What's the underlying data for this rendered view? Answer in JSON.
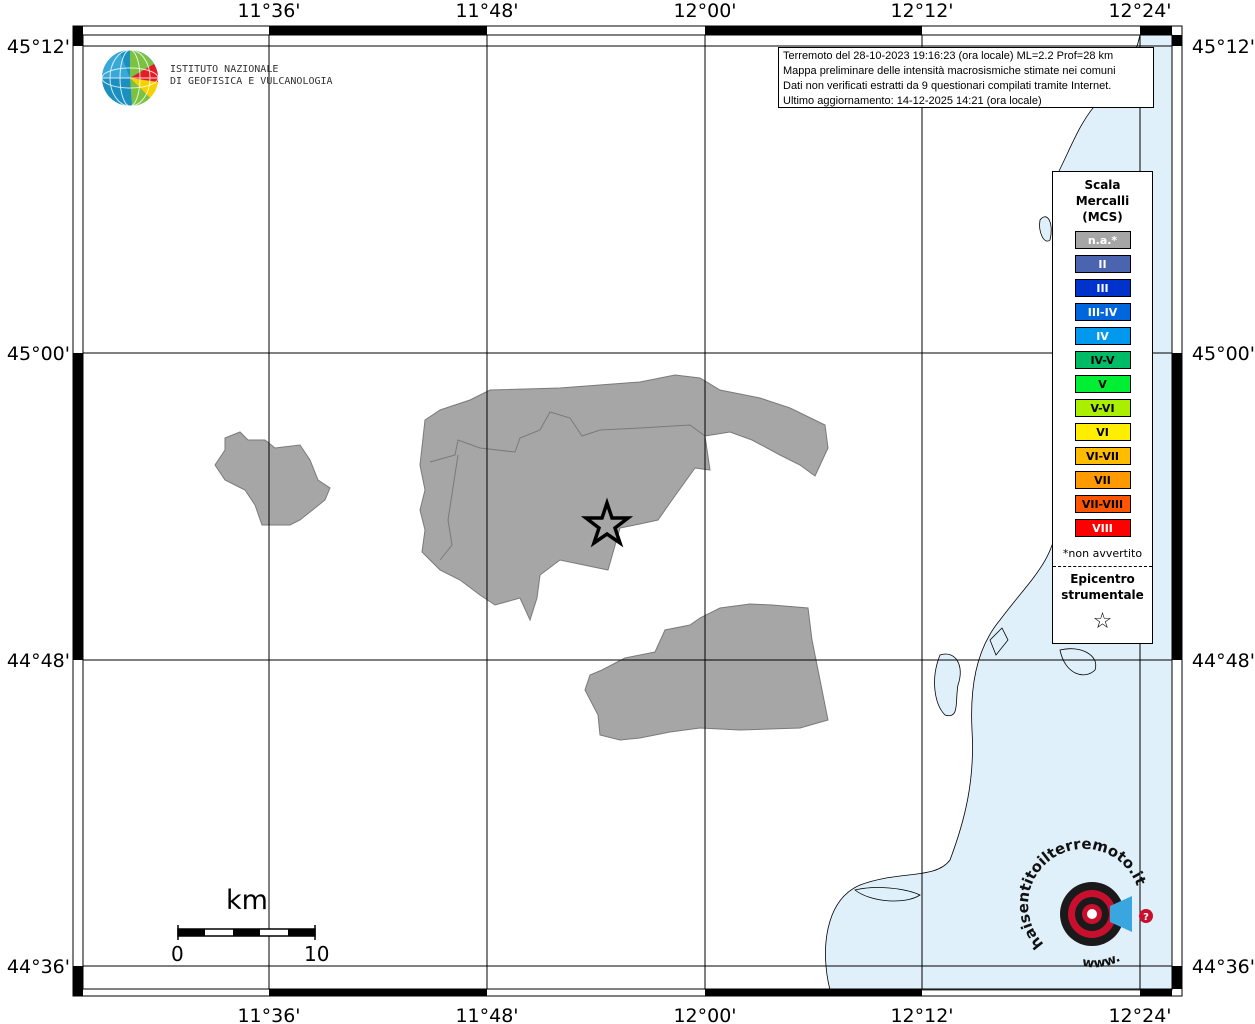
{
  "map": {
    "lat_labels": [
      "45°12'",
      "45°00'",
      "44°48'",
      "44°36'"
    ],
    "lon_labels": [
      "11°36'",
      "11°48'",
      "12°00'",
      "12°12'",
      "12°24'"
    ],
    "land_color": "#ffffff",
    "sea_color": "#e0f0fb",
    "felt_area_color": "#a6a6a6",
    "grid_color": "#000000"
  },
  "logo": {
    "line1": "ISTITUTO NAZIONALE",
    "line2": "DI GEOFISICA E VULCANOLOGIA"
  },
  "info": {
    "line1": "Terremoto del 28-10-2023 19:16:23 (ora locale) ML=2.2 Prof=28 km",
    "line2": "Mappa preliminare delle intensità macrosismiche stimate nei comuni",
    "line3": "Dati non verificati estratti da 9 questionari compilati tramite Internet.",
    "line4": "Ultimo aggiornamento: 14-12-2025 14:21 (ora locale)"
  },
  "legend": {
    "title_line1": "Scala",
    "title_line2": "Mercalli",
    "title_line3": "(MCS)",
    "items": [
      {
        "label": "n.a.*",
        "color": "#a6a6a6"
      },
      {
        "label": "II",
        "color": "#4a64b0"
      },
      {
        "label": "III",
        "color": "#0033cc"
      },
      {
        "label": "III-IV",
        "color": "#0066dd"
      },
      {
        "label": "IV",
        "color": "#0099ee"
      },
      {
        "label": "IV-V",
        "color": "#00bb66"
      },
      {
        "label": "V",
        "color": "#00ee33"
      },
      {
        "label": "V-VI",
        "color": "#aaee00"
      },
      {
        "label": "VI",
        "color": "#ffee00"
      },
      {
        "label": "VI-VII",
        "color": "#ffbb00"
      },
      {
        "label": "VII",
        "color": "#ff9900"
      },
      {
        "label": "VII-VIII",
        "color": "#ff5500"
      },
      {
        "label": "VIII",
        "color": "#ff0000"
      }
    ],
    "note": "*non avvertito",
    "epicentre_line1": "Epicentro",
    "epicentre_line2": "strumentale",
    "epicentre_symbol": "☆"
  },
  "scale": {
    "unit": "km",
    "min": "0",
    "max": "10"
  },
  "brand": {
    "text": "haisentitoilterremoto.it",
    "www": "www."
  }
}
